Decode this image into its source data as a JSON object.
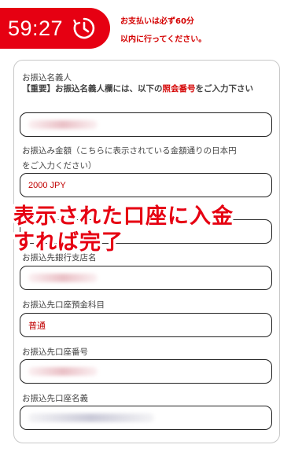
{
  "timer": {
    "time": "59:27",
    "icon": "clock-icon"
  },
  "notice": {
    "line1": "お支払いは必ず60分",
    "line2": "以内に行ってください。"
  },
  "form": {
    "name_label": "お振込名義人",
    "name_note_prefix": "【重要】お振込名義人欄には、以下の",
    "name_note_emphasis": "照会番号",
    "name_note_suffix": "をご入力下さい",
    "amount_label_line1": "お振込み金額（こちらに表示されている金額通りの日本円",
    "amount_label_line2": "をご入力ください）",
    "amount_value": "2000 JPY",
    "bank_label": "お振込先銀行支店名",
    "account_type_label": "お振込先口座預金科目",
    "account_type_value": "普通",
    "account_number_label": "お振込先口座番号",
    "account_name_label": "お振込先口座名義"
  },
  "overlay": {
    "line1": "表示された口座に入金",
    "line2": "すれば完了"
  },
  "colors": {
    "accent": "#e60012",
    "text_red": "#d40000",
    "border": "#222222"
  }
}
